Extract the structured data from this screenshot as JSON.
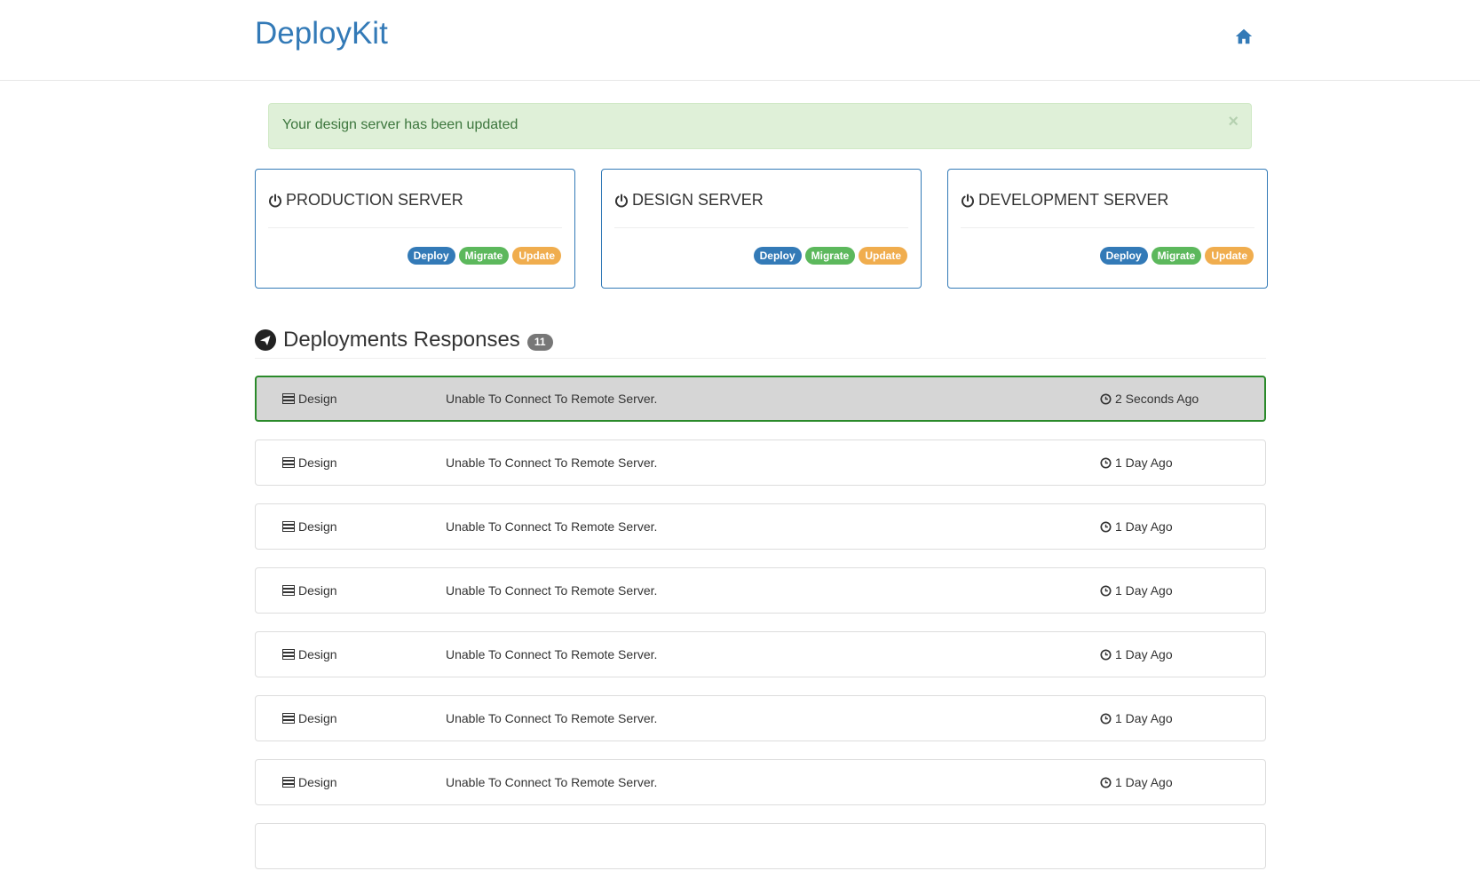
{
  "app": {
    "brand": "DeployKit",
    "home_icon": "home-icon"
  },
  "alert": {
    "message": "Your design server has been updated",
    "close_label": "×",
    "color": "#dff0d8"
  },
  "servers": [
    {
      "name": "PRODUCTION SERVER",
      "icon": "power-icon",
      "actions": {
        "deploy": "Deploy",
        "migrate": "Migrate",
        "update": "Update"
      }
    },
    {
      "name": "DESIGN SERVER",
      "icon": "power-icon",
      "actions": {
        "deploy": "Deploy",
        "migrate": "Migrate",
        "update": "Update"
      }
    },
    {
      "name": "DEVELOPMENT SERVER",
      "icon": "power-icon",
      "actions": {
        "deploy": "Deploy",
        "migrate": "Migrate",
        "update": "Update"
      }
    }
  ],
  "colors": {
    "brand": "#337ab7",
    "deploy": "#337ab7",
    "migrate": "#5cb85c",
    "update": "#f0ad4e",
    "active_row_border": "#2a8a2a",
    "active_row_bg": "#d6d6d6"
  },
  "deployments": {
    "title": "Deployments Responses",
    "icon": "paper-plane-icon",
    "count": "11",
    "rows": [
      {
        "server": "Design",
        "message": "Unable To Connect To Remote Server.",
        "time": "2 Seconds Ago",
        "active": true
      },
      {
        "server": "Design",
        "message": "Unable To Connect To Remote Server.",
        "time": "1 Day Ago"
      },
      {
        "server": "Design",
        "message": "Unable To Connect To Remote Server.",
        "time": "1 Day Ago"
      },
      {
        "server": "Design",
        "message": "Unable To Connect To Remote Server.",
        "time": "1 Day Ago"
      },
      {
        "server": "Design",
        "message": "Unable To Connect To Remote Server.",
        "time": "1 Day Ago"
      },
      {
        "server": "Design",
        "message": "Unable To Connect To Remote Server.",
        "time": "1 Day Ago"
      },
      {
        "server": "Design",
        "message": "Unable To Connect To Remote Server.",
        "time": "1 Day Ago"
      }
    ]
  }
}
